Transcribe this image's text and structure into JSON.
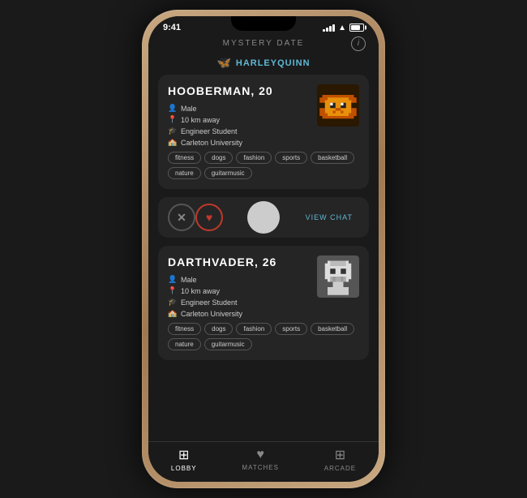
{
  "statusBar": {
    "time": "9:41",
    "battery": 80
  },
  "appName": "MYSTERY DATE",
  "infoButton": "i",
  "currentUser": {
    "icon": "🦋",
    "username": "HARLEYQUINN"
  },
  "profiles": [
    {
      "name": "HOOBERMAN, 20",
      "gender": "Male",
      "distance": "10 km away",
      "occupation": "Engineer Student",
      "university": "Carleton University",
      "tags": [
        "fitness",
        "dogs",
        "fashion",
        "sports",
        "basketball",
        "nature",
        "guitarmusic"
      ],
      "avatarType": "lion"
    },
    {
      "name": "DARTHVADER, 26",
      "gender": "Male",
      "distance": "10 km away",
      "occupation": "Engineer Student",
      "university": "Carleton University",
      "tags": [
        "fitness",
        "dogs",
        "fashion",
        "sports",
        "basketball",
        "nature",
        "guitarmusic"
      ],
      "avatarType": "stormtrooper"
    }
  ],
  "actions": {
    "dismiss": "✕",
    "like": "♥",
    "viewChat": "VIEW CHAT"
  },
  "bottomNav": [
    {
      "id": "lobby",
      "label": "LOBBY",
      "active": true
    },
    {
      "id": "matches",
      "label": "MATCHES",
      "active": false
    },
    {
      "id": "arcade",
      "label": "ARCADE",
      "active": false
    }
  ]
}
